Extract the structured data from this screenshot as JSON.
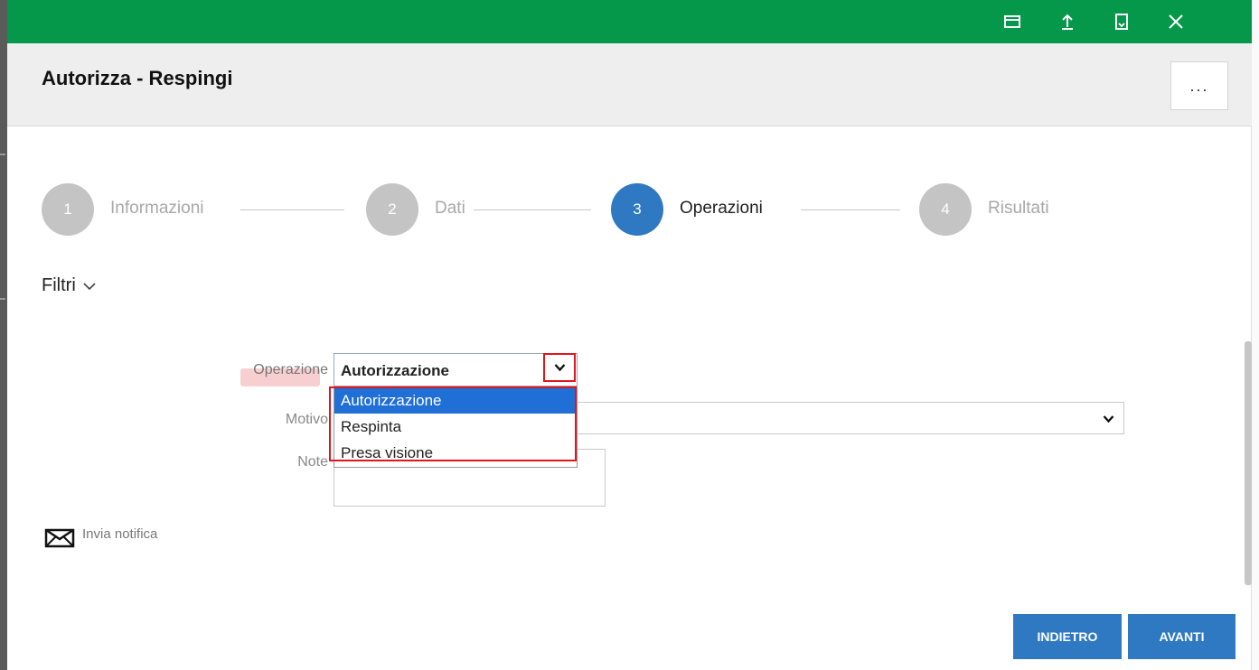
{
  "window": {
    "toolbar_icons": [
      "window-icon",
      "upload-icon",
      "bookmark-icon",
      "close-icon"
    ]
  },
  "header": {
    "title": "Autorizza - Respingi",
    "more_label": "..."
  },
  "stepper": {
    "steps": [
      {
        "number": "1",
        "label": "Informazioni",
        "active": false
      },
      {
        "number": "2",
        "label": "Dati",
        "active": false
      },
      {
        "number": "3",
        "label": "Operazioni",
        "active": true
      },
      {
        "number": "4",
        "label": "Risultati",
        "active": false
      }
    ]
  },
  "filters": {
    "label": "Filtri"
  },
  "form": {
    "operazione_label": "Operazione",
    "operazione_value": "Autorizzazione",
    "operazione_options": [
      "Autorizzazione",
      "Respinta",
      "Presa visione"
    ],
    "motivo_label": "Motivo",
    "note_label": "Note"
  },
  "notification": {
    "label": "Invia notifica"
  },
  "buttons": {
    "back": "INDIETRO",
    "next": "AVANTI"
  },
  "colors": {
    "topbar": "#05974a",
    "accent": "#2f79c3",
    "selection": "#1f6fd6",
    "annotation": "#e0161f"
  }
}
